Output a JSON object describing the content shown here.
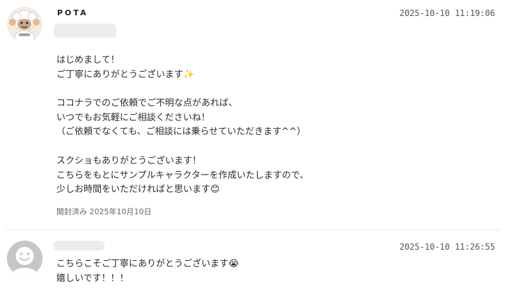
{
  "messages": [
    {
      "sender_name": "POTA",
      "timestamp": "2025-10-10 11:19:06",
      "avatar_icon": "cartoon-sheep-character-icon",
      "lines": [
        "はじめまして！",
        "ご丁寧にありがとうございます",
        "",
        "ココナラでのご依頼でご不明な点があれば、",
        "いつでもお気軽にご相談くださいね！",
        "（ご依頼でなくても、ご相談には乗らせていただきます^^）",
        "",
        "スクショもありがとうございます！",
        "こちらをもとにサンプルキャラクターを作成いたしますので、",
        "少しお時間をいただければと思います"
      ],
      "emoji_line2": "✨",
      "emoji_line10": "😊",
      "read_status": "開封済み 2025年10月10日"
    },
    {
      "timestamp": "2025-10-10 11:26:55",
      "avatar_icon": "default-user-avatar-icon",
      "lines": [
        "こちらこそご丁寧にありがとうございます",
        "嬉しいです！！！"
      ],
      "emoji_line1": "😭"
    }
  ],
  "colors": {
    "text": "#2b2b2b",
    "timestamp": "#555555",
    "divider": "#e6e6e6",
    "placeholder": "#ececec",
    "default_avatar": "#c6c6c6"
  }
}
